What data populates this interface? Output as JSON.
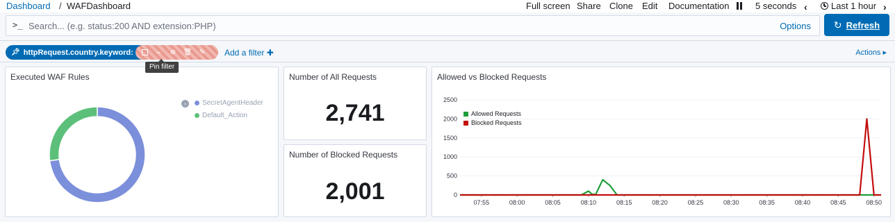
{
  "breadcrumb": {
    "root": "Dashboard",
    "separator": "/",
    "current": "WAFDashboard"
  },
  "topnav": {
    "full_screen": "Full screen",
    "share": "Share",
    "clone": "Clone",
    "edit": "Edit",
    "documentation": "Documentation",
    "interval": "5 seconds",
    "time_range": "Last 1 hour"
  },
  "search": {
    "prompt": ">_",
    "placeholder": "Search... (e.g. status:200 AND extension:PHP)",
    "value": "",
    "options_label": "Options"
  },
  "refresh": {
    "label": "Refresh",
    "icon": "refresh-icon"
  },
  "filters": {
    "pill_label": "httpRequest.country.keyword: \"IN\"",
    "pill_icon": "pin-icon",
    "tooltip": "Pin filter",
    "add_filter": "Add a filter ✚",
    "actions": "Actions ▸"
  },
  "panels": {
    "waf_rules": {
      "title": "Executed WAF Rules",
      "legend": [
        {
          "label": "SecretAgentHeader",
          "color": "#7b8fdb"
        },
        {
          "label": "Default_Action",
          "color": "#5cc07a"
        }
      ],
      "slices": [
        {
          "label": "SecretAgentHeader",
          "value": 73
        },
        {
          "label": "Default_Action",
          "value": 27
        }
      ]
    },
    "all_requests": {
      "title": "Number of All Requests",
      "value": "2,741"
    },
    "blocked_requests": {
      "title": "Number of Blocked Requests",
      "value": "2,001"
    },
    "allowed_vs_blocked": {
      "title": "Allowed vs Blocked Requests"
    }
  },
  "chart_data": {
    "type": "line",
    "title": "Allowed vs Blocked Requests",
    "xlabel": "",
    "ylabel": "",
    "x_ticks": [
      "07:55",
      "08:00",
      "08:05",
      "08:10",
      "08:15",
      "08:20",
      "08:25",
      "08:30",
      "08:35",
      "08:40",
      "08:45",
      "08:50"
    ],
    "y_ticks": [
      0,
      500,
      1000,
      1500,
      2000,
      2500
    ],
    "ylim": [
      0,
      2500
    ],
    "legend_position": "top-left",
    "series": [
      {
        "name": "Allowed Requests",
        "color": "#1e9e3a",
        "points": [
          [
            "07:52",
            0
          ],
          [
            "08:09",
            0
          ],
          [
            "08:10",
            100
          ],
          [
            "08:10:30",
            20
          ],
          [
            "08:11",
            10
          ],
          [
            "08:12",
            400
          ],
          [
            "08:13",
            250
          ],
          [
            "08:14",
            0
          ],
          [
            "08:51",
            0
          ]
        ]
      },
      {
        "name": "Blocked Requests",
        "color": "#c40e0e",
        "points": [
          [
            "07:52",
            0
          ],
          [
            "08:48",
            0
          ],
          [
            "08:49",
            2000
          ],
          [
            "08:50",
            0
          ],
          [
            "08:51",
            0
          ]
        ]
      }
    ]
  }
}
